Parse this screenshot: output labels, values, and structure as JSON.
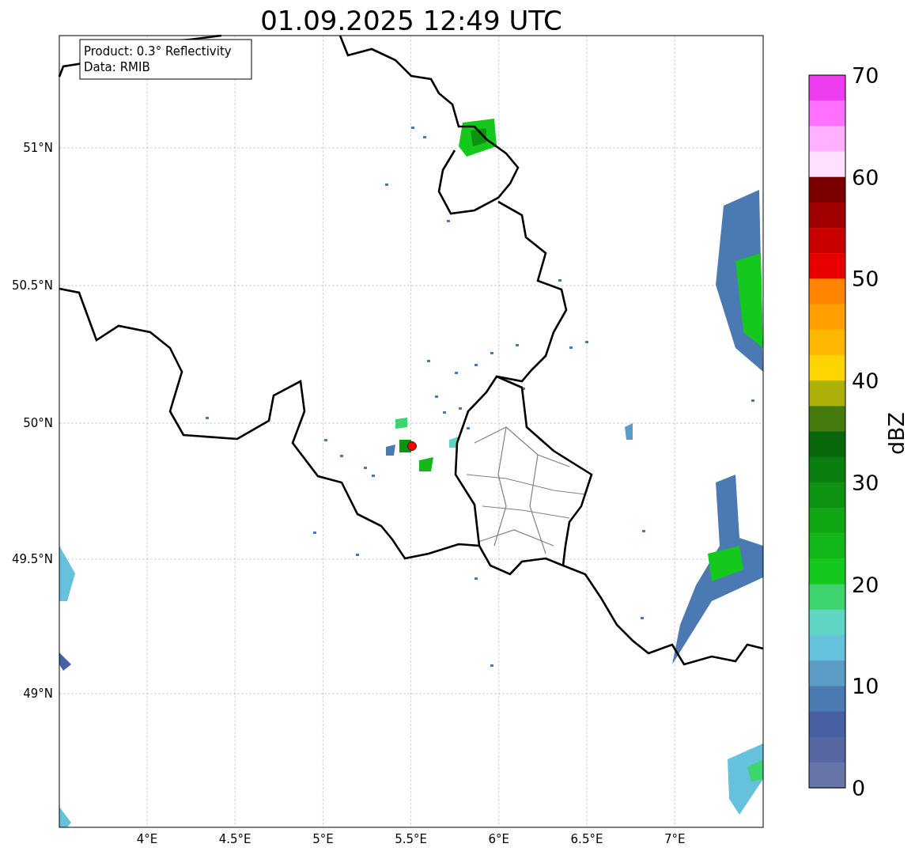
{
  "title": "01.09.2025 12:49 UTC",
  "info_box": [
    "Product: 0.3° Reflectivity",
    "Data: RMIB"
  ],
  "map": {
    "lat_labels": [
      "51°N",
      "50.5°N",
      "50°N",
      "49.5°N",
      "49°N"
    ],
    "lon_labels": [
      "4°E",
      "4.5°E",
      "5°E",
      "5.5°E",
      "6°E",
      "6.5°E",
      "7°E"
    ]
  },
  "colorbar": {
    "label": "dBZ",
    "ticks": [
      "70",
      "60",
      "50",
      "40",
      "30",
      "20",
      "10",
      "0"
    ],
    "bins": [
      {
        "color": "#ee3cf0"
      },
      {
        "color": "#ff70ff"
      },
      {
        "color": "#ffb0ff"
      },
      {
        "color": "#ffe0ff"
      },
      {
        "color": "#7a0000"
      },
      {
        "color": "#a00000"
      },
      {
        "color": "#c80000"
      },
      {
        "color": "#e80000"
      },
      {
        "color": "#ff8400"
      },
      {
        "color": "#ff9f00"
      },
      {
        "color": "#ffb800"
      },
      {
        "color": "#ffd400"
      },
      {
        "color": "#aeb00a"
      },
      {
        "color": "#457a0e"
      },
      {
        "color": "#09680c"
      },
      {
        "color": "#0b7e10"
      },
      {
        "color": "#0e9212"
      },
      {
        "color": "#10a614"
      },
      {
        "color": "#12b81a"
      },
      {
        "color": "#14c81e"
      },
      {
        "color": "#3ed46e"
      },
      {
        "color": "#5fd6c4"
      },
      {
        "color": "#66c1dc"
      },
      {
        "color": "#5a9cc6"
      },
      {
        "color": "#4b7ab2"
      },
      {
        "color": "#4760a4"
      },
      {
        "color": "#5567a0"
      },
      {
        "color": "#6674a8"
      }
    ]
  }
}
